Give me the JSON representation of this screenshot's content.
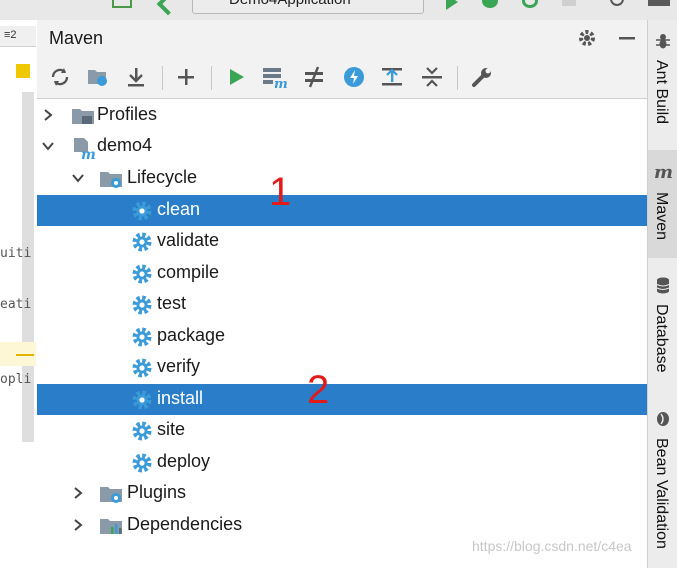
{
  "top_toolbar": {
    "run_config": "Demo4Application"
  },
  "editor": {
    "tab_fragment": "≡2",
    "code_fragments": [
      "uiti",
      "eati",
      "opli"
    ]
  },
  "maven_panel": {
    "title": "Maven",
    "tree": {
      "profiles": "Profiles",
      "project": "demo4",
      "lifecycle": "Lifecycle",
      "phases": [
        "clean",
        "validate",
        "compile",
        "test",
        "package",
        "verify",
        "install",
        "site",
        "deploy"
      ],
      "plugins": "Plugins",
      "dependencies": "Dependencies"
    },
    "selected": [
      "clean",
      "install"
    ],
    "annotations": [
      "1",
      "2"
    ]
  },
  "watermark": "https://blog.csdn.net/c4ea",
  "sidebar": {
    "tabs": [
      "Ant Build",
      "Maven",
      "Database",
      "Bean Validation"
    ],
    "active": "Maven"
  },
  "colors": {
    "selection": "#2a7dc8",
    "gear": "#3a9bd8",
    "run_green": "#3aa655",
    "annotation": "#e31a1a"
  }
}
